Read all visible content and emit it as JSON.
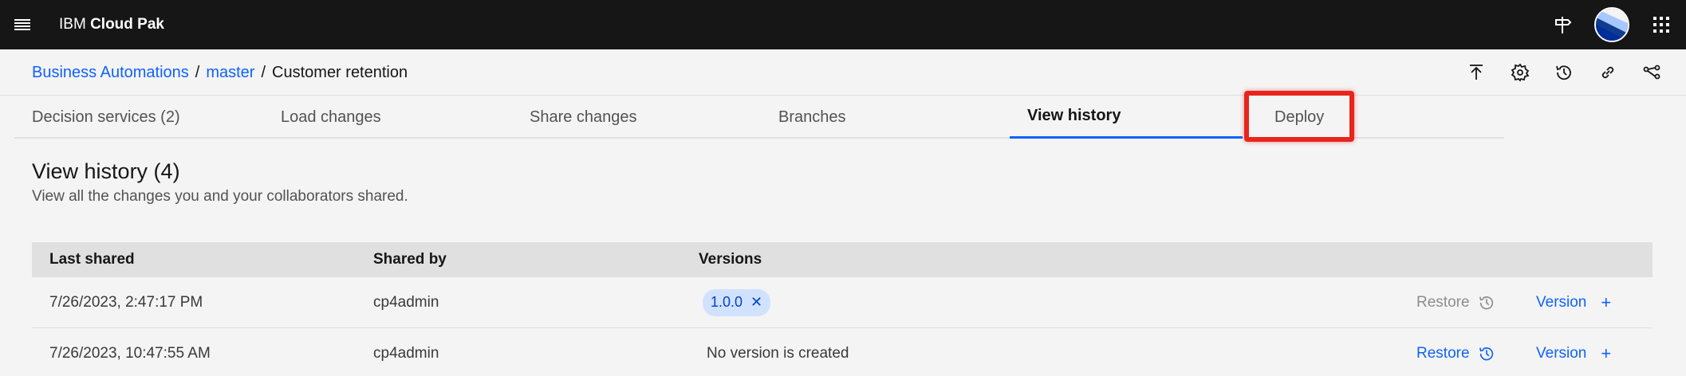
{
  "topbar": {
    "brand_ibm": "IBM",
    "brand_product": "Cloud Pak"
  },
  "breadcrumb": {
    "items": [
      "Business Automations",
      "master"
    ],
    "separator": "/",
    "current": "Customer retention"
  },
  "tabs": [
    {
      "label": "Decision services (2)",
      "active": false
    },
    {
      "label": "Load changes",
      "active": false
    },
    {
      "label": "Share changes",
      "active": false
    },
    {
      "label": "Branches",
      "active": false
    },
    {
      "label": "View history",
      "active": true
    },
    {
      "label": "Deploy",
      "active": false
    }
  ],
  "section": {
    "title": "View history (4)",
    "description": "View all the changes you and your collaborators shared."
  },
  "table": {
    "headers": [
      "Last shared",
      "Shared by",
      "Versions"
    ],
    "rows": [
      {
        "last_shared": "7/26/2023, 2:47:17 PM",
        "shared_by": "cp4admin",
        "version_tag": "1.0.0",
        "restore": "Restore",
        "version_link": "Version"
      },
      {
        "last_shared": "7/26/2023, 10:47:55 AM",
        "shared_by": "cp4admin",
        "version_text": "No version is created",
        "restore": "Restore",
        "version_link": "Version"
      }
    ]
  },
  "colors": {
    "accent": "#0f62fe",
    "topbar": "#161616",
    "highlight": "#e8251c",
    "tag_bg": "#d0e2ff"
  }
}
